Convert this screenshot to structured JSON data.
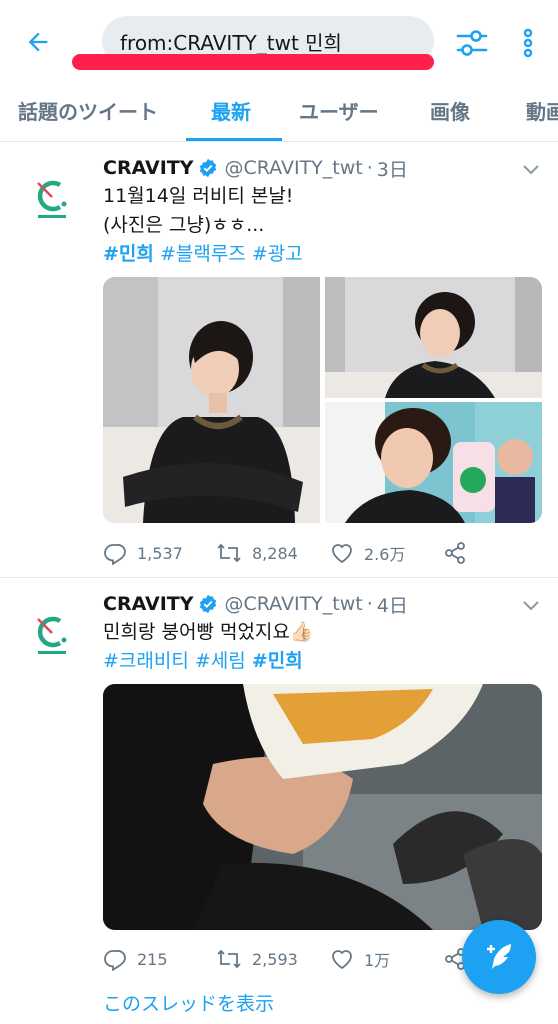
{
  "search": {
    "query": "from:CRAVITY_twt 민희"
  },
  "tabs": [
    {
      "label": "話題のツイート"
    },
    {
      "label": "最新"
    },
    {
      "label": "ユーザー"
    },
    {
      "label": "画像"
    },
    {
      "label": "動画"
    }
  ],
  "tweets": [
    {
      "name": "CRAVITY",
      "handle": "@CRAVITY_twt",
      "dot": "·",
      "time": "3日",
      "line1": "11월14일 러비티 본날!",
      "line2": "(사진은 그냥)ㅎㅎ...",
      "hashtags": [
        "#민희",
        "#블랙루즈",
        "#광고"
      ],
      "replies": "1,537",
      "retweets": "8,284",
      "likes": "2.6万"
    },
    {
      "name": "CRAVITY",
      "handle": "@CRAVITY_twt",
      "dot": "·",
      "time": "4日",
      "line1": "민희랑 붕어빵 먹었지요👍🏻",
      "hashtags": [
        "#크래비티",
        "#세림",
        "#민희"
      ],
      "replies": "215",
      "retweets": "2,593",
      "likes": "1万",
      "thread_link": "このスレッドを表示"
    }
  ],
  "colors": {
    "accent": "#1da1f2",
    "underline_mark": "#ff1f4d",
    "muted": "#657786"
  },
  "icons": [
    "back-arrow-icon",
    "filter-sliders-icon",
    "more-vertical-icon",
    "verified-badge-icon",
    "chevron-down-icon",
    "reply-icon",
    "retweet-icon",
    "like-heart-icon",
    "share-icon",
    "compose-feather-icon"
  ]
}
